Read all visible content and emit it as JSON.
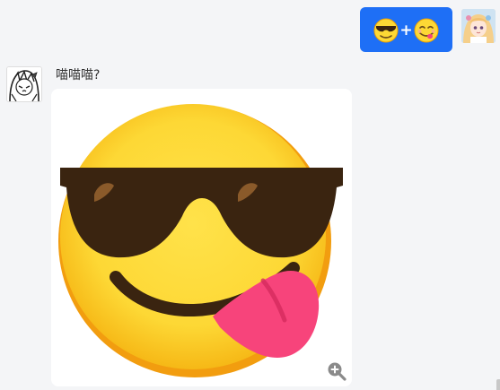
{
  "outgoing": {
    "emoji_left": "cool-face-emoji",
    "separator": "+",
    "emoji_right": "yum-face-emoji"
  },
  "incoming": {
    "sender_name": "喵喵喵?",
    "image_emoji": "cool-yum-mix-emoji"
  },
  "colors": {
    "bubble_blue": "#1e6ff6",
    "background": "#f4f5f7",
    "emoji_yellow": "#fdd835",
    "glasses": "#3a2410",
    "tongue": "#f7447b"
  }
}
